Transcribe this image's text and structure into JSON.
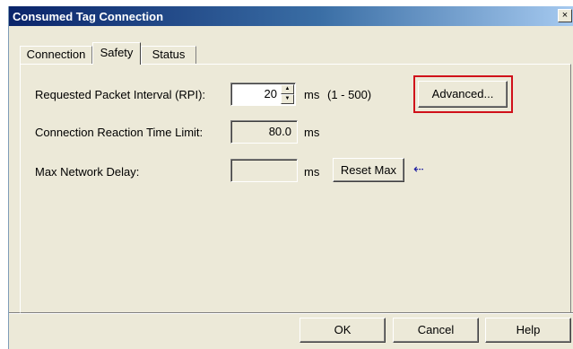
{
  "window": {
    "title": "Consumed Tag Connection",
    "close_glyph": "×"
  },
  "tabs": [
    {
      "label": "Connection"
    },
    {
      "label": "Safety"
    },
    {
      "label": "Status"
    }
  ],
  "safety": {
    "rpi_label": "Requested Packet Interval (RPI):",
    "rpi_value": "20",
    "rpi_unit": "ms",
    "rpi_range": "(1 - 500)",
    "advanced_label": "Advanced...",
    "crtl_label": "Connection Reaction Time Limit:",
    "crtl_value": "80.0",
    "crtl_unit": "ms",
    "mnd_label": "Max Network Delay:",
    "mnd_value": "",
    "mnd_unit": "ms",
    "reset_max_label": "Reset Max",
    "arrow_glyph": "⇠"
  },
  "footer": {
    "ok_label": "OK",
    "cancel_label": "Cancel",
    "help_label": "Help"
  },
  "colors": {
    "highlight_box": "#d0101a",
    "title_bar": "#0a246a",
    "arrow": "#1a1aa0"
  }
}
